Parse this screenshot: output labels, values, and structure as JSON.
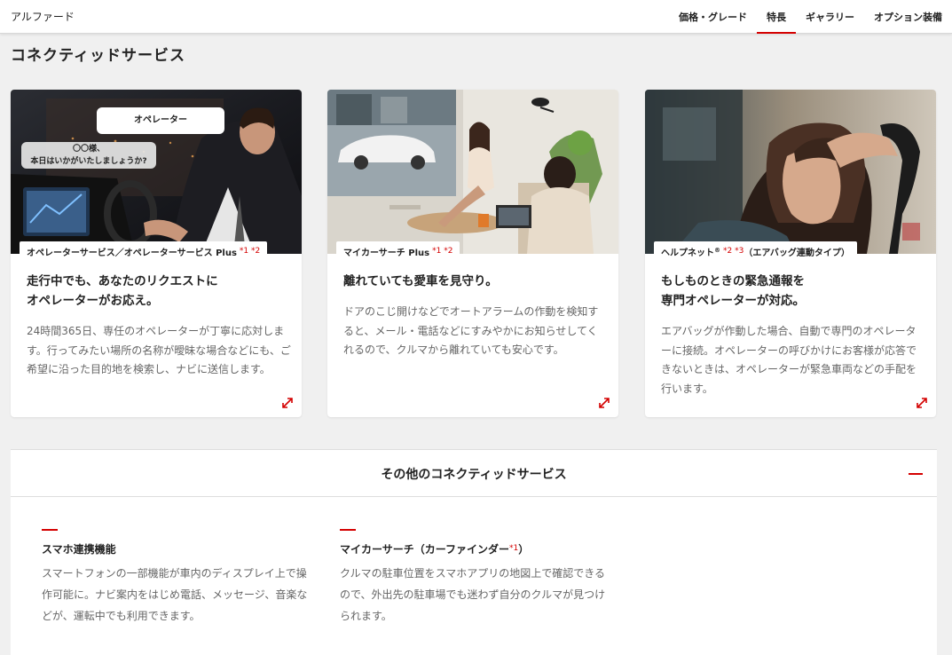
{
  "header": {
    "brand": "アルファード",
    "nav": [
      {
        "label": "価格・グレード"
      },
      {
        "label": "特長"
      },
      {
        "label": "ギャラリー"
      },
      {
        "label": "オプション装備"
      }
    ]
  },
  "page_title": "コネクティッドサービス",
  "cards": [
    {
      "tag": "オペレーターサービス／オペレーターサービス Plus",
      "tag_ref": "*1 *2",
      "bubble_operator": "オペレーター",
      "bubble_line1": "〇〇様、",
      "bubble_line2": "本日はいかがいたしましょうか?",
      "heading_line1": "走行中でも、あなたのリクエストに",
      "heading_line2": "オペレーターがお応え。",
      "body": "24時間365日、専任のオペレーターが丁寧に応対します。行ってみたい場所の名称が曖昧な場合などにも、ご希望に沿った目的地を検索し、ナビに送信します。"
    },
    {
      "tag": "マイカーサーチ Plus",
      "tag_ref": "*1 *2",
      "heading_line1": "離れていても愛車を見守り。",
      "body": "ドアのこじ開けなどでオートアラームの作動を検知すると、メール・電話などにすみやかにお知らせしてくれるので、クルマから離れていても安心です。"
    },
    {
      "tag": "ヘルプネット",
      "tag_reg": "®",
      "tag_ref": "*2 *3",
      "tag_suffix": "（エアバッグ連動タイプ）",
      "heading_line1": "もしものときの緊急通報を",
      "heading_line2": "専門オペレーターが対応。",
      "body": "エアバッグが作動した場合、自動で専門のオペレーターに接続。オペレーターの呼びかけにお客様が応答できないときは、オペレーターが緊急車両などの手配を行います。"
    }
  ],
  "other_services": {
    "title": "その他のコネクティッドサービス",
    "items": [
      {
        "title": "スマホ連携機能",
        "body": "スマートフォンの一部機能が車内のディスプレイ上で操作可能に。ナビ案内をはじめ電話、メッセージ、音楽などが、運転中でも利用できます。"
      },
      {
        "title": "マイカーサーチ（カーファインダー",
        "title_ref": "*1",
        "title_close": "）",
        "body": "クルマの駐車位置をスマホアプリの地図上で確認できるので、外出先の駐車場でも迷わず自分のクルマが見つけられます。"
      }
    ]
  },
  "colors": {
    "accent": "#d40000",
    "text": "#222222",
    "muted": "#666666",
    "page_bg": "#f0f0f0"
  },
  "icons": {
    "expand": "expand-arrows-icon",
    "collapse": "minus-icon"
  }
}
